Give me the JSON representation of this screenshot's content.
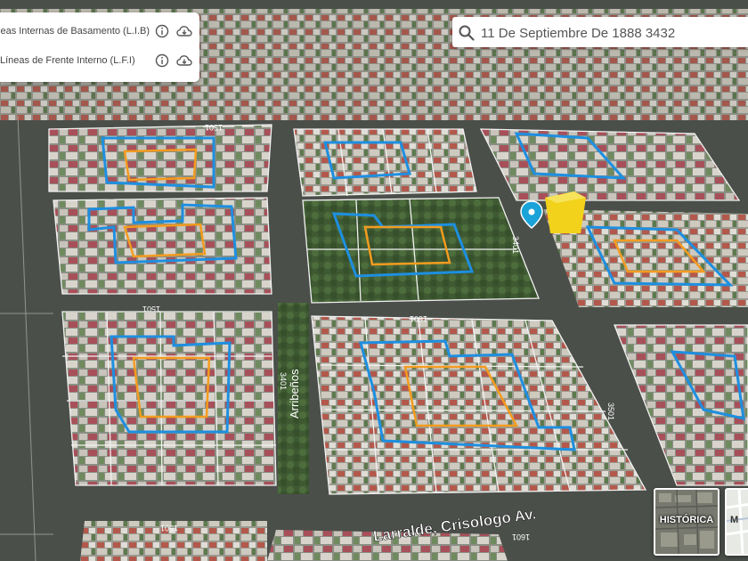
{
  "layers": {
    "items": [
      {
        "label": "Líneas Internas de Basamento (L.I.B)"
      },
      {
        "label": "Líneas de Frente Interno (L.F.I)"
      }
    ]
  },
  "search": {
    "value": "11 De Septiembre De 1888 3432"
  },
  "map": {
    "street_labels": [
      "Larralde, Crisologo Av.",
      "Arribeños"
    ],
    "block_numbers": [
      "1501",
      "1601",
      "3501",
      "3401",
      "1601",
      "1501",
      "3401",
      "1501"
    ]
  },
  "basemap_toggle": {
    "historic_label": "HISTÓRICA",
    "map_label_partial": "M"
  },
  "colors": {
    "lib_line": "#1e8fe0",
    "lfi_line": "#f39c1f",
    "parcel_line": "#f2f2f2",
    "marker": "#1aa3d9",
    "building_highlight": "#f2d21b"
  },
  "icons": {
    "info": "info-icon",
    "download": "cloud-download-icon",
    "search": "search-icon",
    "marker": "location-pin-icon"
  }
}
